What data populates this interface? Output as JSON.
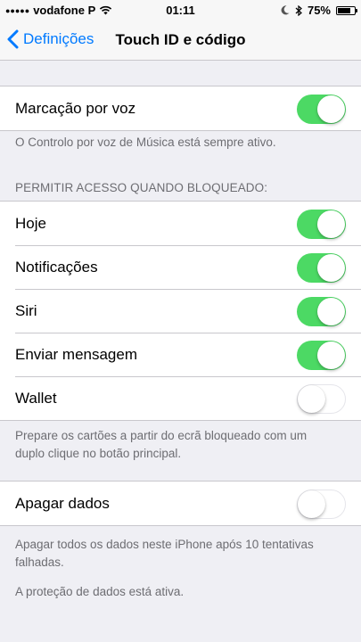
{
  "status_bar": {
    "carrier": "vodafone P",
    "time": "01:11",
    "battery_percent": "75%",
    "battery_level": 0.75,
    "icons": [
      "signal-dots-icon",
      "wifi-icon",
      "moon-icon",
      "bluetooth-icon",
      "battery-icon"
    ]
  },
  "nav": {
    "back_label": "Definições",
    "title": "Touch ID e código"
  },
  "voice": {
    "label": "Marcação por voz",
    "on": true,
    "footer": "O Controlo por voz de Música está sempre ativo."
  },
  "locked_access": {
    "header": "PERMITIR ACESSO QUANDO BLOQUEADO:",
    "items": [
      {
        "label": "Hoje",
        "on": true
      },
      {
        "label": "Notificações",
        "on": true
      },
      {
        "label": "Siri",
        "on": true
      },
      {
        "label": "Enviar mensagem",
        "on": true
      },
      {
        "label": "Wallet",
        "on": false
      }
    ],
    "footer_line1": "Prepare os cartões a partir do ecrã bloqueado com um",
    "footer_line2": "duplo clique no botão principal."
  },
  "erase": {
    "label": "Apagar dados",
    "on": false,
    "footer_line1": "Apagar todos os dados neste iPhone após 10 tentativas",
    "footer_line2": "falhadas.",
    "protection": "A proteção de dados está ativa."
  },
  "colors": {
    "accent": "#007aff",
    "toggle_on": "#4cd964",
    "background": "#efeff4",
    "footer_text": "#6d6d72"
  }
}
